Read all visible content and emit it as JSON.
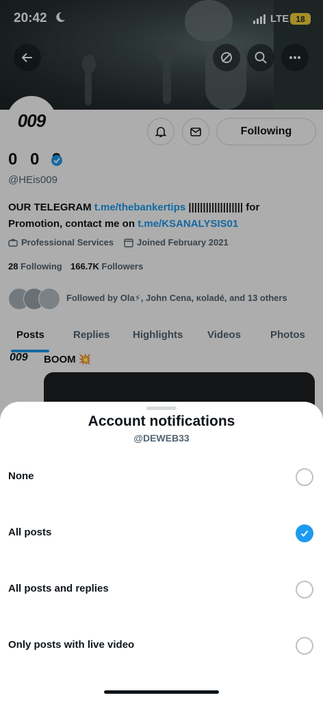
{
  "status_bar": {
    "time": "20:42",
    "network": "LTE",
    "battery": "18"
  },
  "profile": {
    "avatar_text": "009",
    "name": "0 0 9",
    "handle": "@HEis009",
    "bio_line1_prefix": "OUR TELEGRAM ",
    "bio_link1": "t.me/thebankertips",
    "bio_line1_suffix": " ||||||||||||||||||| for",
    "bio_line2_prefix": "Promotion, contact me on ",
    "bio_link2": "t.me/KSANALYSIS01",
    "category": "Professional Services",
    "joined": "Joined February 2021",
    "following_count": "28",
    "following_label": "Following",
    "followers_count": "166.7K",
    "followers_label": "Followers",
    "followed_by": "Followed by Ola⚡, John Cena, κoladé, and 13 others",
    "following_button": "Following"
  },
  "tabs": [
    "Posts",
    "Replies",
    "Highlights",
    "Videos",
    "Photos"
  ],
  "post": {
    "avatar_text": "009",
    "text": "BOOM 💥"
  },
  "sheet": {
    "title": "Account notifications",
    "subtitle": "@DEWEB33",
    "options": [
      {
        "label": "None",
        "checked": false
      },
      {
        "label": "All posts",
        "checked": true
      },
      {
        "label": "All posts and replies",
        "checked": false
      },
      {
        "label": "Only posts with live video",
        "checked": false
      }
    ]
  },
  "colors": {
    "accent": "#1d9bf0",
    "text": "#0f1419",
    "muted": "#536471"
  }
}
